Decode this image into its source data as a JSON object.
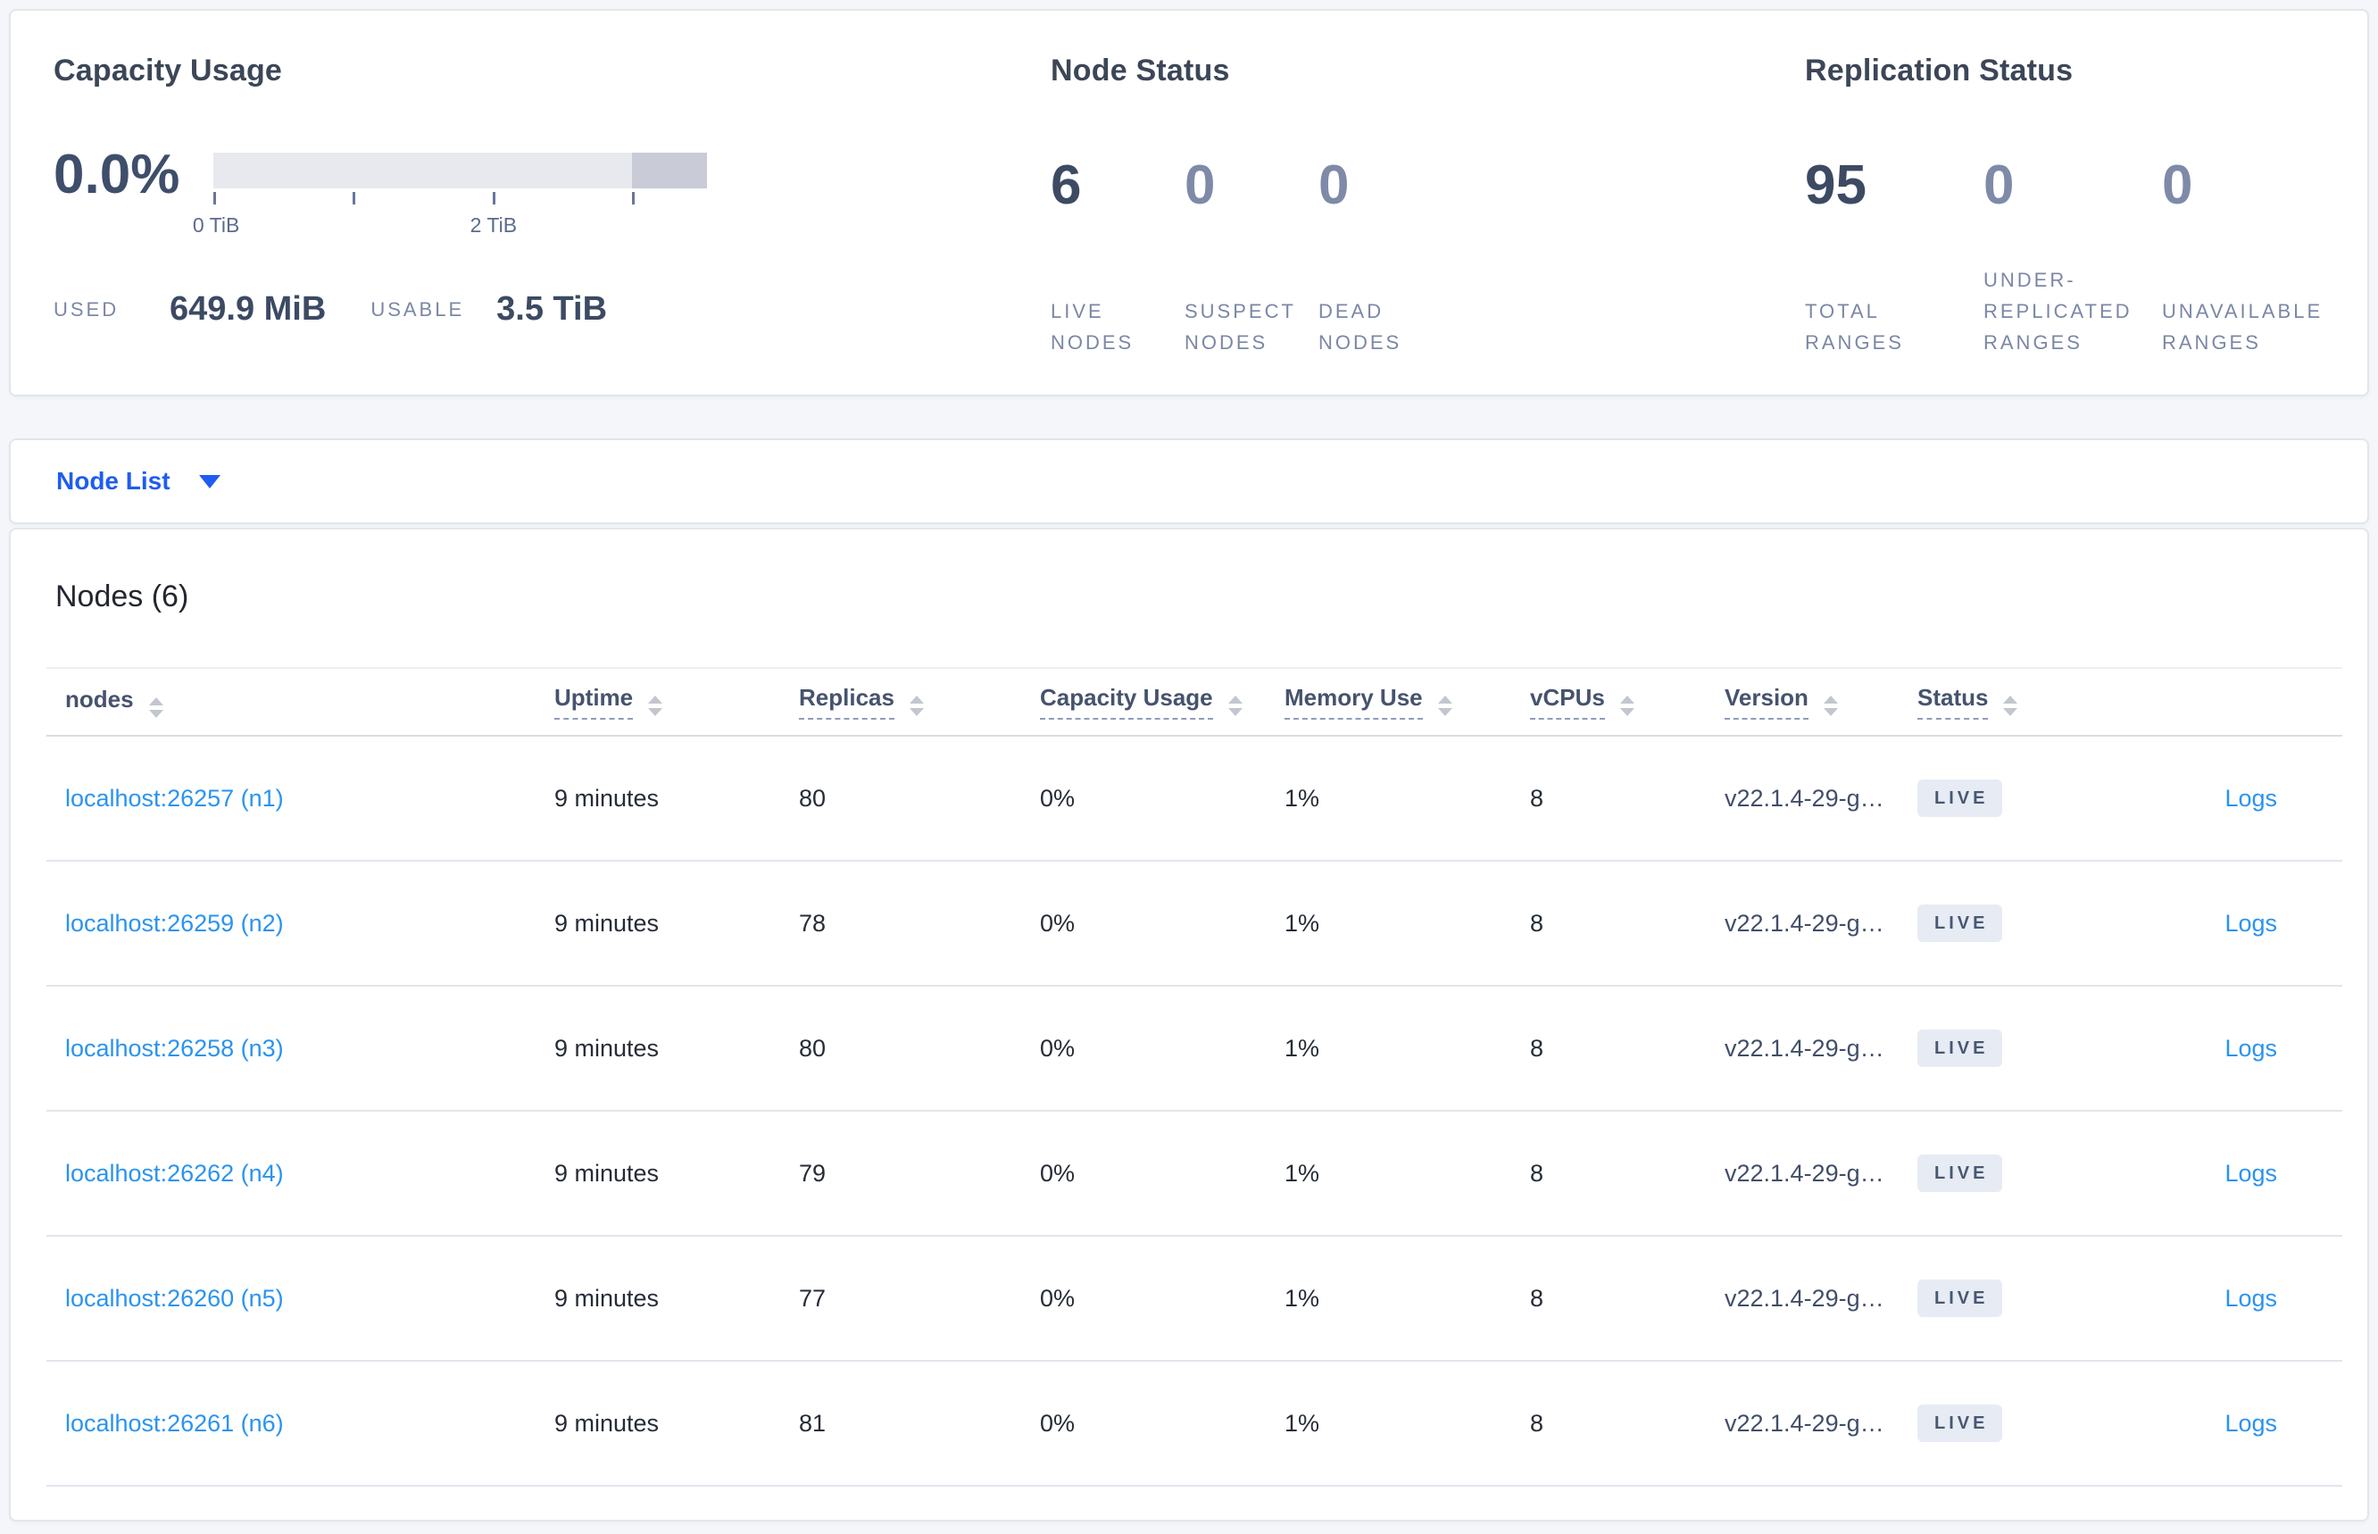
{
  "capacity": {
    "title": "Capacity Usage",
    "percent": "0.0%",
    "bar": {
      "usable_color": "#e7e9ee",
      "reserved_color": "#c9ccd6",
      "reserved_fraction_percent": 15.3,
      "tick_positions_percent": [
        0,
        28.2,
        56.5,
        84.7
      ],
      "tick_label_0": "0 TiB",
      "tick_label_2": "2 TiB"
    },
    "used_label": "USED",
    "used_value": "649.9 MiB",
    "usable_label": "USABLE",
    "usable_value": "3.5 TiB"
  },
  "node_status": {
    "title": "Node Status",
    "items": [
      {
        "value": "6",
        "label": "LIVE NODES",
        "muted": false
      },
      {
        "value": "0",
        "label": "SUSPECT NODES",
        "muted": true
      },
      {
        "value": "0",
        "label": "DEAD NODES",
        "muted": true
      }
    ]
  },
  "replication_status": {
    "title": "Replication Status",
    "items": [
      {
        "value": "95",
        "label": "TOTAL RANGES",
        "muted": false
      },
      {
        "value": "0",
        "label": "UNDER-REPLICATED RANGES",
        "muted": true
      },
      {
        "value": "0",
        "label": "UNAVAILABLE RANGES",
        "muted": true
      }
    ]
  },
  "node_list_dropdown": {
    "label": "Node List"
  },
  "nodes_table": {
    "title": "Nodes (6)",
    "columns": [
      {
        "key": "node",
        "label": "nodes",
        "underlined": false
      },
      {
        "key": "uptime",
        "label": "Uptime",
        "underlined": true
      },
      {
        "key": "replicas",
        "label": "Replicas",
        "underlined": true
      },
      {
        "key": "capacity_usage",
        "label": "Capacity Usage",
        "underlined": true
      },
      {
        "key": "memory_use",
        "label": "Memory Use",
        "underlined": true
      },
      {
        "key": "vcpus",
        "label": "vCPUs",
        "underlined": true
      },
      {
        "key": "version",
        "label": "Version",
        "underlined": true
      },
      {
        "key": "status",
        "label": "Status",
        "underlined": true
      }
    ],
    "rows": [
      {
        "node": "localhost:26257 (n1)",
        "uptime": "9 minutes",
        "replicas": "80",
        "capacity_usage": "0%",
        "memory_use": "1%",
        "vcpus": "8",
        "version": "v22.1.4-29-g…",
        "status": "LIVE",
        "logs": "Logs"
      },
      {
        "node": "localhost:26259 (n2)",
        "uptime": "9 minutes",
        "replicas": "78",
        "capacity_usage": "0%",
        "memory_use": "1%",
        "vcpus": "8",
        "version": "v22.1.4-29-g…",
        "status": "LIVE",
        "logs": "Logs"
      },
      {
        "node": "localhost:26258 (n3)",
        "uptime": "9 minutes",
        "replicas": "80",
        "capacity_usage": "0%",
        "memory_use": "1%",
        "vcpus": "8",
        "version": "v22.1.4-29-g…",
        "status": "LIVE",
        "logs": "Logs"
      },
      {
        "node": "localhost:26262 (n4)",
        "uptime": "9 minutes",
        "replicas": "79",
        "capacity_usage": "0%",
        "memory_use": "1%",
        "vcpus": "8",
        "version": "v22.1.4-29-g…",
        "status": "LIVE",
        "logs": "Logs"
      },
      {
        "node": "localhost:26260 (n5)",
        "uptime": "9 minutes",
        "replicas": "77",
        "capacity_usage": "0%",
        "memory_use": "1%",
        "vcpus": "8",
        "version": "v22.1.4-29-g…",
        "status": "LIVE",
        "logs": "Logs"
      },
      {
        "node": "localhost:26261 (n6)",
        "uptime": "9 minutes",
        "replicas": "81",
        "capacity_usage": "0%",
        "memory_use": "1%",
        "vcpus": "8",
        "version": "v22.1.4-29-g…",
        "status": "LIVE",
        "logs": "Logs"
      }
    ]
  },
  "colors": {
    "page_background": "#f4f6f9",
    "accent_link_blue": "#1f5cf0",
    "table_link_blue": "#2b93f0",
    "dark_stat_text": "#3d4a63",
    "muted_stat_text": "#7e8aa8",
    "badge_background": "#e7ebf3"
  }
}
